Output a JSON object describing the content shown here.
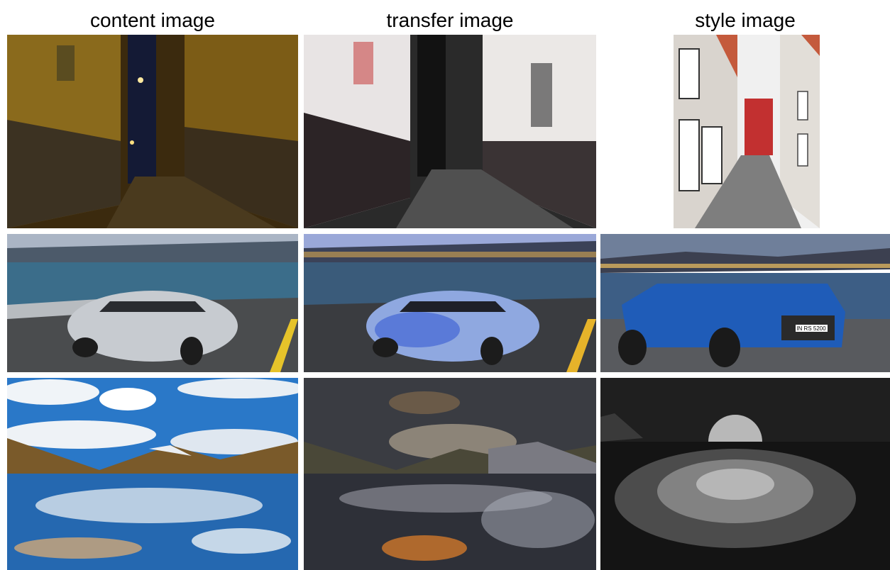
{
  "headers": {
    "content": "content image",
    "transfer": "transfer image",
    "style": "style image"
  },
  "rows": [
    {
      "content": "night street",
      "transfer": "stylized street",
      "style": "daytime street"
    },
    {
      "content": "silver car",
      "transfer": "stylized car",
      "style": "blue convertible"
    },
    {
      "content": "mountain lake",
      "transfer": "stylized lake",
      "style": "moonlit sea"
    }
  ],
  "plate_text": "IN RS 5200"
}
